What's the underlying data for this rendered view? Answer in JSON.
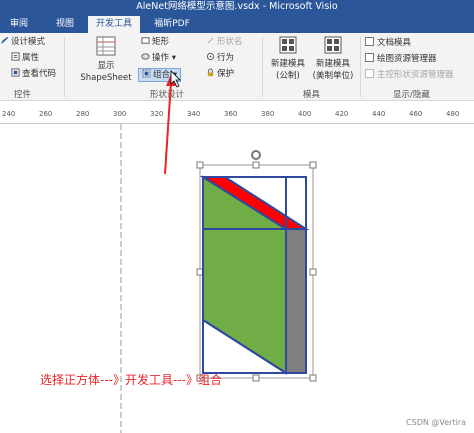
{
  "window": {
    "title": "AleNet网络模型示意图.vsdx - Microsoft Visio"
  },
  "tabs": [
    {
      "label": "审阅"
    },
    {
      "label": "视图"
    },
    {
      "label": "开发工具"
    },
    {
      "label": "福昕PDF"
    }
  ],
  "ribbon": {
    "code_group": {
      "design_mode": "设计模式",
      "properties": "属性",
      "view_code": "查看代码",
      "label": "控件"
    },
    "show_shapesheet": {
      "line1": "显示",
      "line2": "ShapeSheet"
    },
    "shape_design": {
      "rectangle": "矩形",
      "operation": "操作",
      "group": "组合",
      "shape_name": "形状名",
      "behavior": "行为",
      "protection": "保护",
      "label": "形状设计"
    },
    "template": {
      "new_stencil_metric": {
        "line1": "新建模具",
        "line2": "(公制)"
      },
      "new_stencil_us": {
        "line1": "新建模具",
        "line2": "(美制单位)"
      },
      "label": "模具"
    },
    "show_hide": {
      "document_stencil": "文档模具",
      "drawing_explorer": "绘图资源管理器",
      "master_explorer": "主控形状资源管理器",
      "label": "显示/隐藏"
    }
  },
  "ruler": {
    "ticks": [
      "240",
      "260",
      "280",
      "300",
      "320",
      "340",
      "360",
      "380",
      "400",
      "420",
      "440",
      "460",
      "480"
    ]
  },
  "annotation": {
    "text": "选择正方体---》开发工具---》组合"
  },
  "watermark": {
    "text": "CSDN @Vertira"
  },
  "colors": {
    "ribbon_blue": "#2b579a",
    "face_green": "#70ad47",
    "face_gray": "#7f7f7f",
    "edge_red": "#ff0000",
    "edge_blue": "#2e4a9e",
    "annotation_red": "#e8242a"
  }
}
